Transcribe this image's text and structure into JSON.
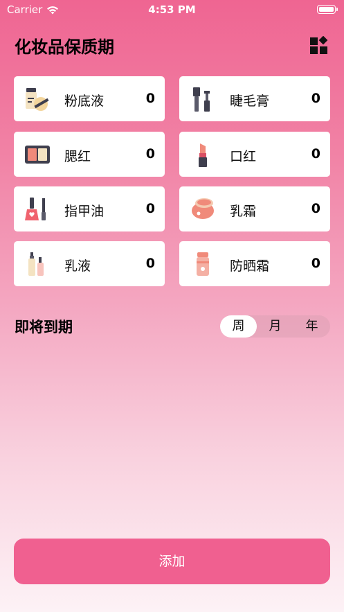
{
  "status_bar": {
    "carrier": "Carrier",
    "time": "4:53 PM"
  },
  "header": {
    "title": "化妆品保质期"
  },
  "categories": [
    {
      "label": "粉底液",
      "count": "0",
      "icon": "foundation-icon"
    },
    {
      "label": "睫毛膏",
      "count": "0",
      "icon": "mascara-icon"
    },
    {
      "label": "腮红",
      "count": "0",
      "icon": "blush-icon"
    },
    {
      "label": "口红",
      "count": "0",
      "icon": "lipstick-icon"
    },
    {
      "label": "指甲油",
      "count": "0",
      "icon": "nail-polish-icon"
    },
    {
      "label": "乳霜",
      "count": "0",
      "icon": "cream-jar-icon"
    },
    {
      "label": "乳液",
      "count": "0",
      "icon": "lotion-bottles-icon"
    },
    {
      "label": "防晒霜",
      "count": "0",
      "icon": "sunscreen-icon"
    }
  ],
  "expiring": {
    "title": "即将到期",
    "segments": [
      "周",
      "月",
      "年"
    ],
    "selected": "周"
  },
  "add_button": {
    "label": "添加"
  },
  "colors": {
    "accent": "#f06090",
    "card": "#ffffff"
  }
}
